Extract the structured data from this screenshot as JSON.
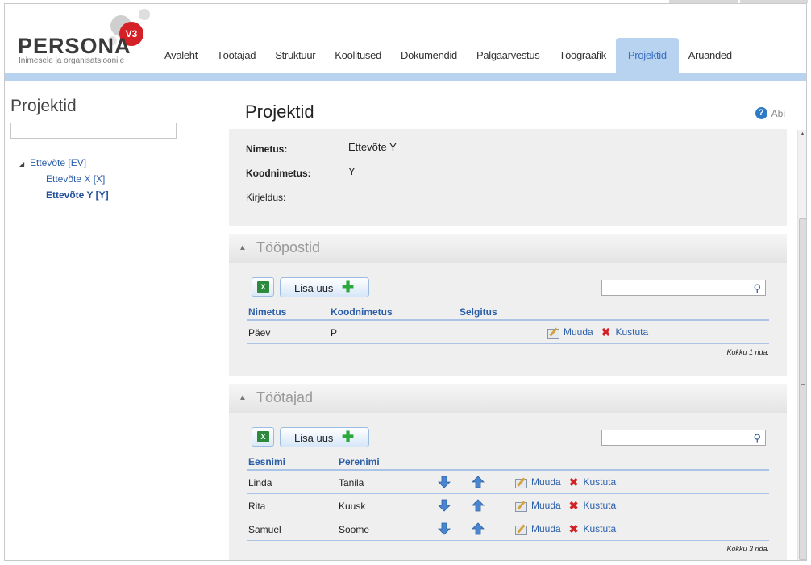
{
  "app": {
    "logo_word": "PERSONA",
    "logo_version": "V3",
    "logo_tagline": "Inimesele ja organisatsioonile"
  },
  "nav": {
    "tabs": [
      {
        "label": "Avaleht"
      },
      {
        "label": "Töötajad"
      },
      {
        "label": "Struktuur"
      },
      {
        "label": "Koolitused"
      },
      {
        "label": "Dokumendid"
      },
      {
        "label": "Palgaarvestus"
      },
      {
        "label": "Töögraafik"
      },
      {
        "label": "Projektid"
      },
      {
        "label": "Aruanded"
      }
    ],
    "active": "Projektid"
  },
  "sidebar": {
    "title": "Projektid",
    "search_value": "",
    "tree": {
      "root": "Ettevõte [EV]",
      "children": [
        "Ettevõte X [X]",
        "Ettevõte Y [Y]"
      ],
      "selected": "Ettevõte Y [Y]"
    }
  },
  "main": {
    "title": "Projektid",
    "help_label": "Abi",
    "info": {
      "name_label": "Nimetus:",
      "name_value": "Ettevõte Y",
      "code_label": "Koodnimetus:",
      "code_value": "Y",
      "desc_label": "Kirjeldus:",
      "desc_value": ""
    },
    "positions": {
      "title": "Tööpostid",
      "add_label": "Lisa uus",
      "search_value": "",
      "columns": [
        "Nimetus",
        "Koodnimetus",
        "Selgitus"
      ],
      "rows": [
        {
          "name": "Päev",
          "code": "P",
          "note": ""
        }
      ],
      "edit_label": "Muuda",
      "delete_label": "Kustuta",
      "total": "Kokku 1 rida."
    },
    "employees": {
      "title": "Töötajad",
      "add_label": "Lisa uus",
      "search_value": "",
      "columns": [
        "Eesnimi",
        "Perenimi"
      ],
      "rows": [
        {
          "first": "Linda",
          "last": "Tanila"
        },
        {
          "first": "Rita",
          "last": "Kuusk"
        },
        {
          "first": "Samuel",
          "last": "Soome"
        }
      ],
      "edit_label": "Muuda",
      "delete_label": "Kustuta",
      "total": "Kokku 3 rida."
    }
  },
  "colors": {
    "accent": "#b8d3ef",
    "link": "#2b5ea8",
    "brand_red": "#d42027",
    "add_green": "#2aa83a"
  },
  "icons": {
    "excel": "excel-export-icon",
    "add": "plus-icon",
    "search": "magnifier-icon",
    "edit": "edit-icon",
    "delete": "delete-x-icon",
    "down": "arrow-down-icon",
    "up": "arrow-up-icon",
    "help": "help-icon"
  }
}
